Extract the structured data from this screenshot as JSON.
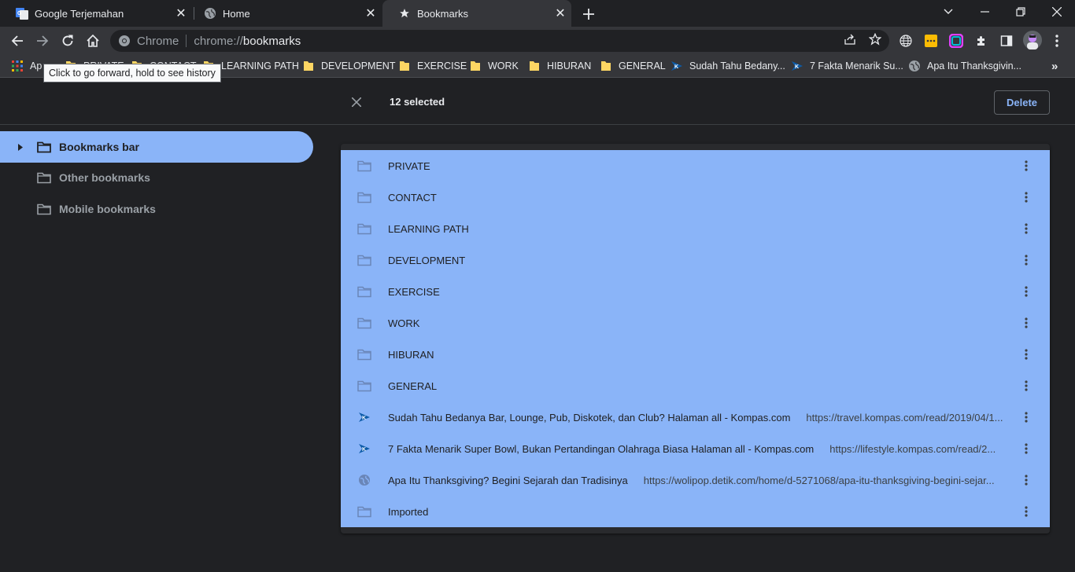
{
  "tabs": [
    {
      "title": "Google Terjemahan",
      "icon": "google-translate-icon"
    },
    {
      "title": "Home",
      "icon": "globe-icon"
    },
    {
      "title": "Bookmarks",
      "icon": "star-icon",
      "active": true
    }
  ],
  "omnibox": {
    "chip_label": "Chrome",
    "url_scheme": "chrome://",
    "url_host": "bookmarks"
  },
  "bookmarks_bar": [
    {
      "label": "Ap",
      "icon": "apps-icon"
    },
    {
      "label": "PRIVATE",
      "icon": "folder-icon"
    },
    {
      "label": "CONTACT",
      "icon": "folder-icon"
    },
    {
      "label": "LEARNING PATH",
      "icon": "folder-icon"
    },
    {
      "label": "DEVELOPMENT",
      "icon": "folder-icon"
    },
    {
      "label": "EXERCISE",
      "icon": "folder-icon"
    },
    {
      "label": "WORK",
      "icon": "folder-icon"
    },
    {
      "label": "HIBURAN",
      "icon": "folder-icon"
    },
    {
      "label": "GENERAL",
      "icon": "folder-icon"
    },
    {
      "label": "Sudah Tahu Bedany...",
      "icon": "kompas-icon"
    },
    {
      "label": "7 Fakta Menarik Su...",
      "icon": "kompas-icon"
    },
    {
      "label": "Apa Itu Thanksgivin...",
      "icon": "globe-icon"
    }
  ],
  "tooltip": "Click to go forward, hold to see history",
  "selection": {
    "count_label": "12 selected",
    "delete_label": "Delete"
  },
  "sidebar": [
    {
      "label": "Bookmarks bar",
      "active": true
    },
    {
      "label": "Other bookmarks"
    },
    {
      "label": "Mobile bookmarks"
    }
  ],
  "items": [
    {
      "title": "PRIVATE",
      "url": "",
      "icon": "folder-icon"
    },
    {
      "title": "CONTACT",
      "url": "",
      "icon": "folder-icon"
    },
    {
      "title": "LEARNING PATH",
      "url": "",
      "icon": "folder-icon"
    },
    {
      "title": "DEVELOPMENT",
      "url": "",
      "icon": "folder-icon"
    },
    {
      "title": "EXERCISE",
      "url": "",
      "icon": "folder-icon"
    },
    {
      "title": "WORK",
      "url": "",
      "icon": "folder-icon"
    },
    {
      "title": "HIBURAN",
      "url": "",
      "icon": "folder-icon"
    },
    {
      "title": "GENERAL",
      "url": "",
      "icon": "folder-icon"
    },
    {
      "title": "Sudah Tahu Bedanya Bar, Lounge, Pub, Diskotek, dan Club? Halaman all - Kompas.com",
      "url": "https://travel.kompas.com/read/2019/04/1...",
      "icon": "kompas-icon"
    },
    {
      "title": "7 Fakta Menarik Super Bowl, Bukan Pertandingan Olahraga Biasa Halaman all - Kompas.com",
      "url": "https://lifestyle.kompas.com/read/2...",
      "icon": "kompas-icon"
    },
    {
      "title": "Apa Itu Thanksgiving? Begini Sejarah dan Tradisinya",
      "url": "https://wolipop.detik.com/home/d-5271068/apa-itu-thanksgiving-begini-sejar...",
      "icon": "globe-icon"
    },
    {
      "title": "Imported",
      "url": "",
      "icon": "folder-icon"
    }
  ],
  "colors": {
    "accent": "#8ab4f8",
    "background": "#202124",
    "toolbar": "#35363a"
  }
}
